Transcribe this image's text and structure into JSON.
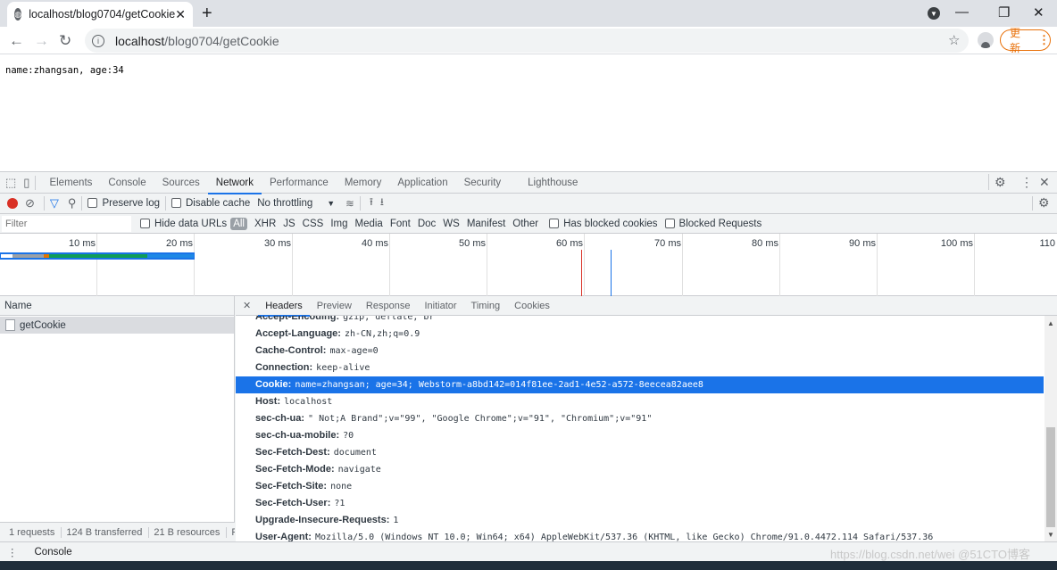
{
  "browser": {
    "tab_title": "localhost/blog0704/getCookie",
    "new_tab": "+",
    "window_controls": {
      "minimize": "—",
      "restore": "❐",
      "close": "✕"
    },
    "url_host": "localhost",
    "url_path": "/blog0704/getCookie",
    "update_label": "更新",
    "update_menu": "⋮"
  },
  "page": {
    "text": "name:zhangsan, age:34"
  },
  "devtools": {
    "tabs": [
      "Elements",
      "Console",
      "Sources",
      "Network",
      "Performance",
      "Memory",
      "Application",
      "Security",
      "Lighthouse"
    ],
    "active_tab": "Network",
    "toolbar": {
      "preserve_log": "Preserve log",
      "disable_cache": "Disable cache",
      "throttling": "No throttling"
    },
    "filter": {
      "placeholder": "Filter",
      "hide_data_urls": "Hide data URLs",
      "types": [
        "All",
        "XHR",
        "JS",
        "CSS",
        "Img",
        "Media",
        "Font",
        "Doc",
        "WS",
        "Manifest",
        "Other"
      ],
      "has_blocked_cookies": "Has blocked cookies",
      "blocked_requests": "Blocked Requests"
    },
    "overview": {
      "ticks": [
        "10 ms",
        "20 ms",
        "30 ms",
        "40 ms",
        "50 ms",
        "60 ms",
        "70 ms",
        "80 ms",
        "90 ms",
        "100 ms",
        "110"
      ]
    },
    "request_list": {
      "header": "Name",
      "rows": [
        {
          "name": "getCookie"
        }
      ],
      "summary": [
        "1 requests",
        "124 B transferred",
        "21 B resources",
        "Fi"
      ]
    },
    "detail_tabs": [
      "Headers",
      "Preview",
      "Response",
      "Initiator",
      "Timing",
      "Cookies"
    ],
    "active_detail_tab": "Headers",
    "headers": [
      {
        "key": "Accept-Encoding:",
        "value": "gzip, deflate, br"
      },
      {
        "key": "Accept-Language:",
        "value": "zh-CN,zh;q=0.9"
      },
      {
        "key": "Cache-Control:",
        "value": "max-age=0"
      },
      {
        "key": "Connection:",
        "value": "keep-alive"
      },
      {
        "key": "Cookie:",
        "value": "name=zhangsan; age=34; Webstorm-a8bd142=014f81ee-2ad1-4e52-a572-8eecea82aee8",
        "selected": true
      },
      {
        "key": "Host:",
        "value": "localhost"
      },
      {
        "key": "sec-ch-ua:",
        "value": "\" Not;A Brand\";v=\"99\", \"Google Chrome\";v=\"91\", \"Chromium\";v=\"91\""
      },
      {
        "key": "sec-ch-ua-mobile:",
        "value": "?0"
      },
      {
        "key": "Sec-Fetch-Dest:",
        "value": "document"
      },
      {
        "key": "Sec-Fetch-Mode:",
        "value": "navigate"
      },
      {
        "key": "Sec-Fetch-Site:",
        "value": "none"
      },
      {
        "key": "Sec-Fetch-User:",
        "value": "?1"
      },
      {
        "key": "Upgrade-Insecure-Requests:",
        "value": "1"
      },
      {
        "key": "User-Agent:",
        "value": "Mozilla/5.0 (Windows NT 10.0; Win64; x64) AppleWebKit/537.36 (KHTML, like Gecko) Chrome/91.0.4472.114 Safari/537.36"
      }
    ],
    "drawer_tab": "Console"
  },
  "watermark": "https://blog.csdn.net/wei @51CTO博客",
  "colors": {
    "accent": "#1a73e8",
    "record": "#d93025",
    "update": "#e8710a"
  }
}
